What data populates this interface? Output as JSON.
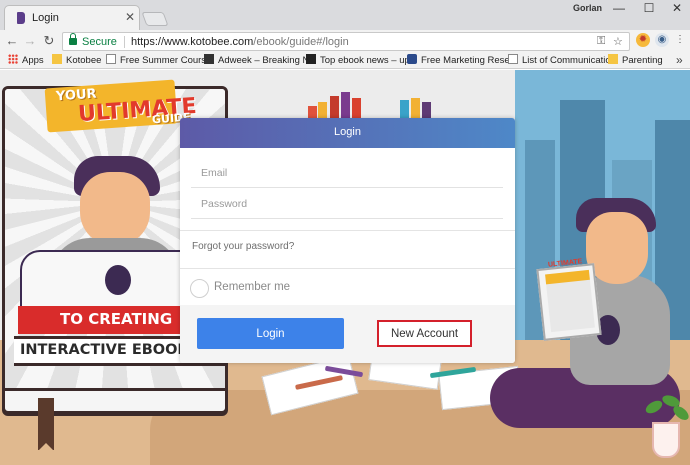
{
  "browser": {
    "tab": {
      "title": "Login",
      "favicon": "kotobee-book-icon"
    },
    "user_badge": "Gorlan",
    "window_controls": {
      "minimize": "—",
      "maximize": "☐",
      "close": "✕"
    },
    "address_bar": {
      "secure_label": "Secure",
      "url_host": "https://www.kotobee.com",
      "url_path": "/ebook/guide#/login"
    },
    "bookmarks": [
      {
        "label": "Apps",
        "icon": "apps-grid-icon"
      },
      {
        "label": "Kotobee",
        "icon": "folder-icon"
      },
      {
        "label": "Free Summer Course",
        "icon": "page-icon"
      },
      {
        "label": "Adweek – Breaking N",
        "icon": "adweek-icon"
      },
      {
        "label": "Top ebook news – up",
        "icon": "ebook-news-icon"
      },
      {
        "label": "Free Marketing Resea",
        "icon": "marketing-icon"
      },
      {
        "label": "List of Communicatio",
        "icon": "page-icon"
      },
      {
        "label": "Parenting",
        "icon": "folder-icon"
      }
    ]
  },
  "background_art": {
    "cover_banner_line1": "YOUR",
    "cover_banner_line2": "ULTIMATE",
    "cover_banner_line3": "GUIDE",
    "cover_ribbon1": "TO CREATING",
    "cover_ribbon2": "INTERACTIVE EBOOKS!",
    "small_book_label": "ULTIMATE"
  },
  "login_modal": {
    "title": "Login",
    "email_placeholder": "Email",
    "password_placeholder": "Password",
    "forgot_link": "Forgot your password?",
    "remember_label": "Remember me",
    "remember_checked": false,
    "login_button": "Login",
    "new_account_button": "New Account"
  },
  "colors": {
    "header_gradient_start": "#5d5aa7",
    "header_gradient_end": "#4e88c8",
    "login_button": "#3d82e9",
    "new_account_outline": "#d4202b",
    "secure_green": "#0b8043"
  }
}
